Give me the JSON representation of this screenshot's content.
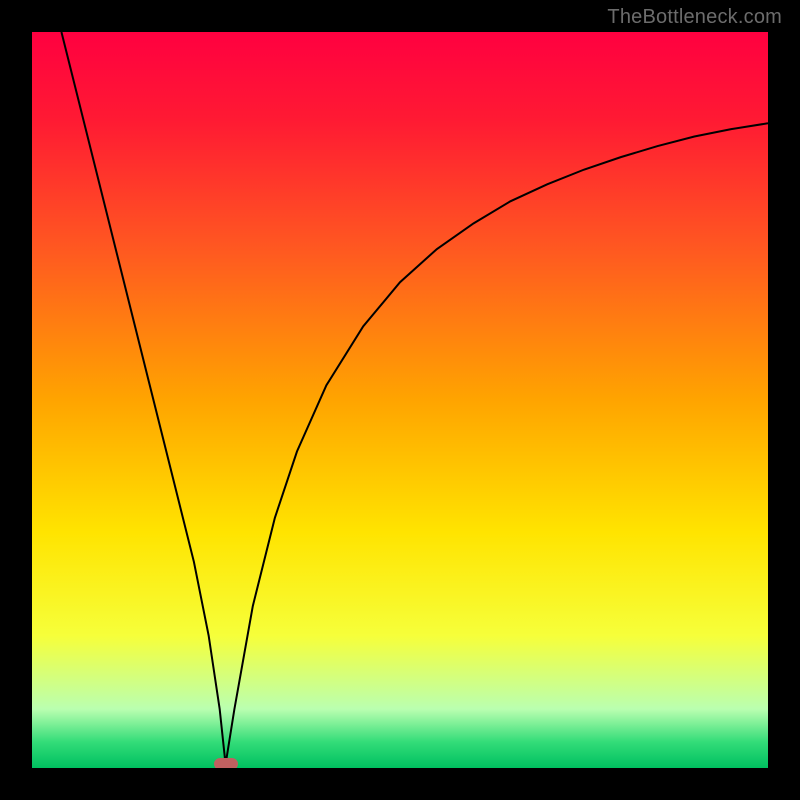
{
  "watermark": {
    "text": "TheBottleneck.com"
  },
  "chart_data": {
    "type": "line",
    "title": "",
    "xlabel": "",
    "ylabel": "",
    "xlim": [
      0,
      100
    ],
    "ylim": [
      0,
      100
    ],
    "grid": false,
    "legend": false,
    "background_gradient": {
      "stops": [
        {
          "offset": 0.0,
          "color": "#ff0040"
        },
        {
          "offset": 0.12,
          "color": "#ff1a33"
        },
        {
          "offset": 0.3,
          "color": "#ff5a20"
        },
        {
          "offset": 0.5,
          "color": "#ffa400"
        },
        {
          "offset": 0.68,
          "color": "#ffe400"
        },
        {
          "offset": 0.82,
          "color": "#f6ff3a"
        },
        {
          "offset": 0.92,
          "color": "#baffb0"
        },
        {
          "offset": 0.965,
          "color": "#32dc78"
        },
        {
          "offset": 1.0,
          "color": "#00c060"
        }
      ]
    },
    "series": [
      {
        "name": "bottleneck-curve",
        "color": "#000000",
        "x": [
          4,
          6,
          8,
          10,
          12,
          14,
          16,
          18,
          20,
          22,
          24,
          25.5,
          26.3,
          27.5,
          30,
          33,
          36,
          40,
          45,
          50,
          55,
          60,
          65,
          70,
          75,
          80,
          85,
          90,
          95,
          100
        ],
        "y": [
          100,
          92,
          84,
          76,
          68,
          60,
          52,
          44,
          36,
          28,
          18,
          8,
          0.5,
          8,
          22,
          34,
          43,
          52,
          60,
          66,
          70.5,
          74,
          77,
          79.3,
          81.3,
          83,
          84.5,
          85.8,
          86.8,
          87.6
        ]
      }
    ],
    "marker": {
      "name": "optimum-point",
      "x": 26.3,
      "y": 0.5,
      "color": "#c06060"
    }
  }
}
